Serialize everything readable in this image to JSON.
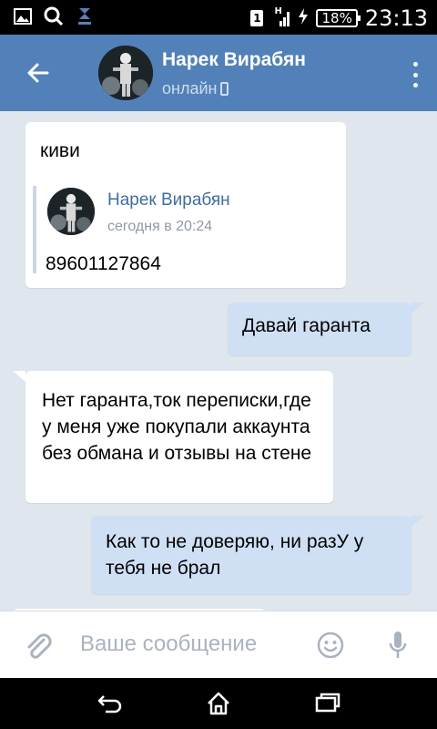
{
  "statusbar": {
    "icons": [
      "gallery-icon",
      "search-icon",
      "app-icon"
    ],
    "sim_label": "1",
    "network_label": "H",
    "battery": "18%",
    "time": "23:13"
  },
  "header": {
    "title": "Нарек Вирабян",
    "status": "онлайн",
    "accent_color": "#5181b8"
  },
  "messages": [
    {
      "direction": "in",
      "text": "киви",
      "forwarded": {
        "name": "Нарек Вирабян",
        "date": "сегодня в 20:24",
        "text": "89601127864"
      }
    },
    {
      "direction": "out",
      "text": "Давай гаранта"
    },
    {
      "direction": "in",
      "text": "Нет гаранта,ток переписки,где у меня уже покупали аккаунта без обмана и отзывы на стене"
    },
    {
      "direction": "out",
      "text": "Как то не доверяю, ни разУ у тебя не брал"
    }
  ],
  "input": {
    "placeholder": "Ваше сообщение"
  },
  "navbar": {
    "buttons": [
      "back-icon",
      "home-icon",
      "recent-apps-icon"
    ]
  }
}
